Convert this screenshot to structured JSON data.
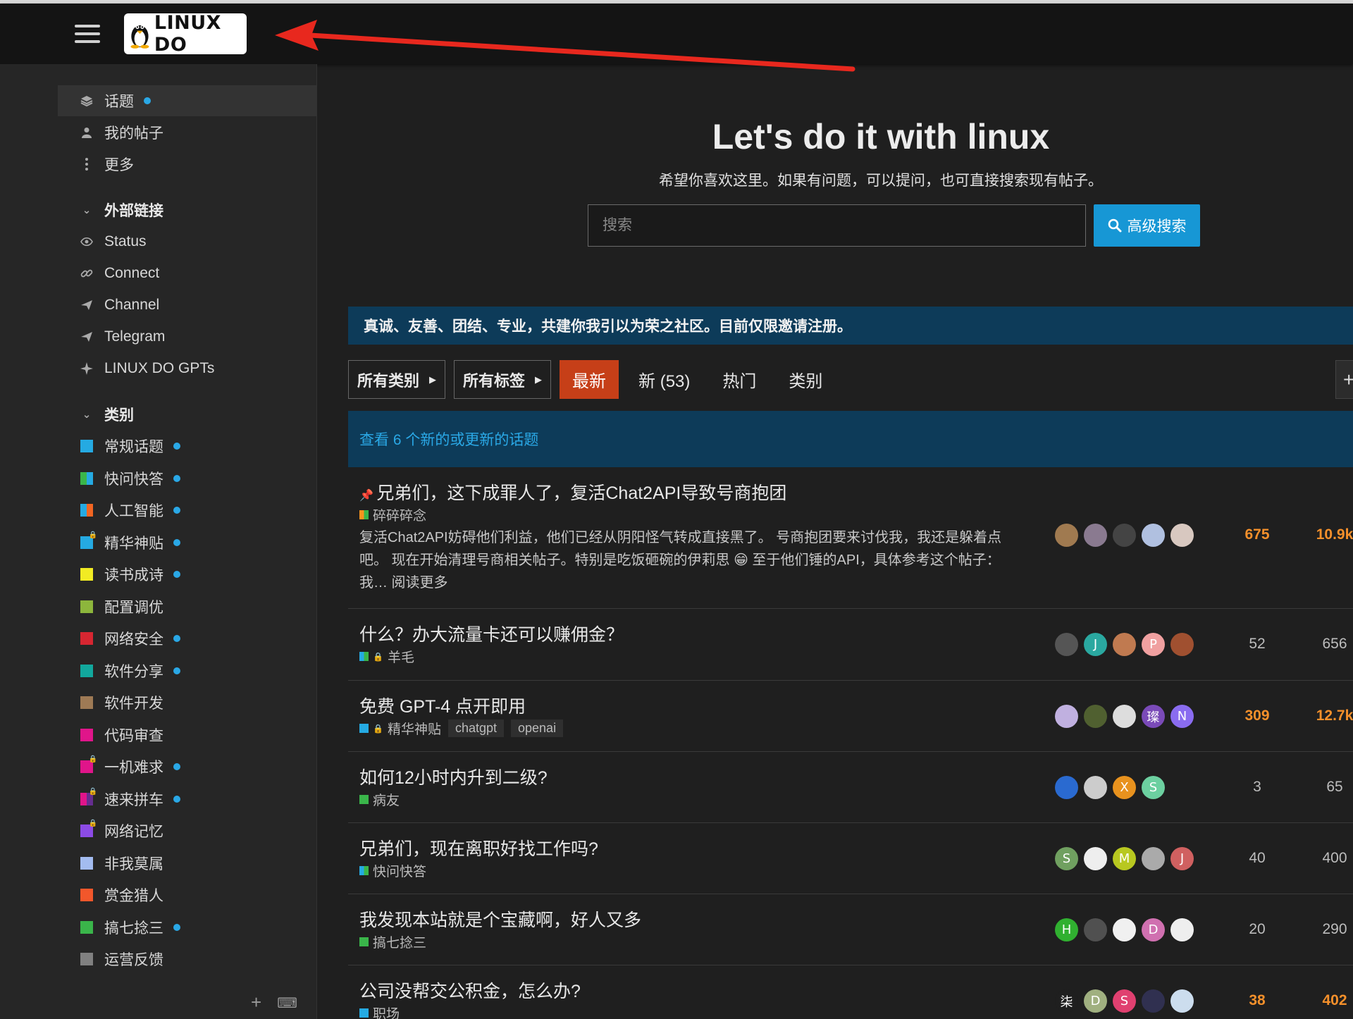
{
  "header": {
    "logo_text": "LINUX DO"
  },
  "sidebar": {
    "top_items": [
      {
        "label": "话题",
        "icon": "layers-icon"
      },
      {
        "label": "我的帖子",
        "icon": "user-icon"
      },
      {
        "label": "更多",
        "icon": "more-vertical-icon"
      }
    ],
    "links_header": "外部链接",
    "links": [
      {
        "label": "Status",
        "icon": "eye-icon"
      },
      {
        "label": "Connect",
        "icon": "link-icon"
      },
      {
        "label": "Channel",
        "icon": "send-icon"
      },
      {
        "label": "Telegram",
        "icon": "send-icon"
      },
      {
        "label": "LINUX DO GPTs",
        "icon": "sparkle-icon"
      }
    ],
    "categories_header": "类别",
    "categories": [
      {
        "label": "常规话题",
        "color": "#25AAE2",
        "dot": true
      },
      {
        "label": "快问快答",
        "color": "#3AB54A",
        "color2": "#25AAE2",
        "dot": true
      },
      {
        "label": "人工智能",
        "color": "#25AAE2",
        "color2": "#F26522",
        "dot": true
      },
      {
        "label": "精华神贴",
        "color": "#25AAE2",
        "lock": true,
        "dot": true
      },
      {
        "label": "读书成诗",
        "color": "#F1EB23",
        "dot": true
      },
      {
        "label": "配置调优",
        "color": "#8DB63C",
        "dot": false
      },
      {
        "label": "网络安全",
        "color": "#D72631",
        "dot": true
      },
      {
        "label": "软件分享",
        "color": "#12A89D",
        "dot": true
      },
      {
        "label": "软件开发",
        "color": "#9E7A55",
        "dot": false
      },
      {
        "label": "代码审查",
        "color": "#E0158A",
        "dot": false
      },
      {
        "label": "一机难求",
        "color": "#E0158A",
        "lock": true,
        "dot": true
      },
      {
        "label": "速来拼车",
        "color": "#E0158A",
        "color2": "#652D90",
        "lock": true,
        "dot": true
      },
      {
        "label": "网络记忆",
        "color": "#8C4BE6",
        "lock": true,
        "dot": false
      },
      {
        "label": "非我莫属",
        "color": "#A3BCF0",
        "dot": false
      },
      {
        "label": "赏金猎人",
        "color": "#F2572B",
        "dot": false
      },
      {
        "label": "搞七捻三",
        "color": "#3AB54A",
        "dot": true
      },
      {
        "label": "运营反馈",
        "color": "#808080",
        "dot": false
      }
    ]
  },
  "hero": {
    "title": "Let's do it with linux",
    "subtitle": "希望你喜欢这里。如果有问题，可以提问，也可直接搜索现有帖子。",
    "search_placeholder": "搜索",
    "advanced_search_label": "高级搜索"
  },
  "banner": "真诚、友善、团结、专业，共建你我引以为荣之社区。目前仅限邀请注册。",
  "nav": {
    "all_categories": "所有类别",
    "all_tags": "所有标签",
    "tabs": [
      "最新",
      "新 (53)",
      "热门",
      "类别"
    ]
  },
  "new_topics_notice": "查看 6 个新的或更新的话题",
  "topics": [
    {
      "title": "兄弟们，这下成罪人了，复活Chat2API导致号商抱团",
      "pinned": true,
      "category": "碎碎碎念",
      "cat_color": "#F7941D",
      "cat_color2": "#3AB54A",
      "excerpt": "复活Chat2API妨碍他们利益，他们已经从阴阳怪气转成直接黑了。 号商抱团要来讨伐我，我还是躲着点吧。 现在开始清理号商相关帖子。特别是吃饭砸碗的伊莉思 😁 至于他们锤的API，具体参考这个帖子： 我… 阅读更多",
      "avatars": [
        {
          "c": "#a07a50",
          "t": ""
        },
        {
          "c": "#8a7a90",
          "t": ""
        },
        {
          "c": "#444",
          "t": ""
        },
        {
          "c": "#b0c0e0",
          "t": ""
        },
        {
          "c": "#d8c8c0",
          "t": ""
        }
      ],
      "replies": "675",
      "views": "10.9k",
      "hot": true
    },
    {
      "title": "什么？办大流量卡还可以赚佣金？",
      "category": "羊毛",
      "lock": true,
      "cat_color": "#25AAE2",
      "cat_color2": "#3AB54A",
      "avatars": [
        {
          "c": "#555",
          "t": ""
        },
        {
          "c": "#2aa8a0",
          "t": "J"
        },
        {
          "c": "#c07a50",
          "t": ""
        },
        {
          "c": "#f0a0a0",
          "t": "P"
        },
        {
          "c": "#a05030",
          "t": ""
        }
      ],
      "replies": "52",
      "views": "656",
      "hot": false
    },
    {
      "title": "免费 GPT-4 点开即用",
      "category": "精华神贴",
      "lock": true,
      "cat_color": "#25AAE2",
      "tags": [
        "chatgpt",
        "openai"
      ],
      "avatars": [
        {
          "c": "#c0b0e0",
          "t": ""
        },
        {
          "c": "#506030",
          "t": ""
        },
        {
          "c": "#ddd",
          "t": ""
        },
        {
          "c": "#7a4ab8",
          "t": "璨"
        },
        {
          "c": "#8a6cf0",
          "t": "N"
        }
      ],
      "replies": "309",
      "views": "12.7k",
      "hot": true
    },
    {
      "title": "如何12小时内升到二级?",
      "category": "病友",
      "cat_color": "#3AB54A",
      "avatars": [
        {
          "c": "#2a6ad0",
          "t": ""
        },
        {
          "c": "#ccc",
          "t": ""
        },
        {
          "c": "#e8921e",
          "t": "X"
        },
        {
          "c": "#6cd0a0",
          "t": "S"
        }
      ],
      "replies": "3",
      "views": "65",
      "hot": false
    },
    {
      "title": "兄弟们，现在离职好找工作吗?",
      "category": "快问快答",
      "cat_color": "#25AAE2",
      "cat_color2": "#3AB54A",
      "avatars": [
        {
          "c": "#70a060",
          "t": "S"
        },
        {
          "c": "#eee",
          "t": ""
        },
        {
          "c": "#b8c820",
          "t": "M"
        },
        {
          "c": "#aaa",
          "t": ""
        },
        {
          "c": "#d06060",
          "t": "J"
        }
      ],
      "replies": "40",
      "views": "400",
      "hot": false
    },
    {
      "title": "我发现本站就是个宝藏啊，好人又多",
      "category": "搞七捻三",
      "cat_color": "#3AB54A",
      "avatars": [
        {
          "c": "#30b030",
          "t": "H"
        },
        {
          "c": "#505050",
          "t": ""
        },
        {
          "c": "#f0f0f0",
          "t": ""
        },
        {
          "c": "#d070b0",
          "t": "D"
        },
        {
          "c": "#eee",
          "t": ""
        }
      ],
      "replies": "20",
      "views": "290",
      "hot": false
    },
    {
      "title": "公司没帮交公积金，怎么办?",
      "category": "职场",
      "cat_color": "#25AAE2",
      "avatars": [
        {
          "c": "#1f1f1f",
          "t": "柒"
        },
        {
          "c": "#a0b080",
          "t": "D"
        },
        {
          "c": "#e04070",
          "t": "S"
        },
        {
          "c": "#303050",
          "t": ""
        },
        {
          "c": "#cde",
          "t": ""
        }
      ],
      "replies": "38",
      "views": "402",
      "hot": true
    }
  ]
}
